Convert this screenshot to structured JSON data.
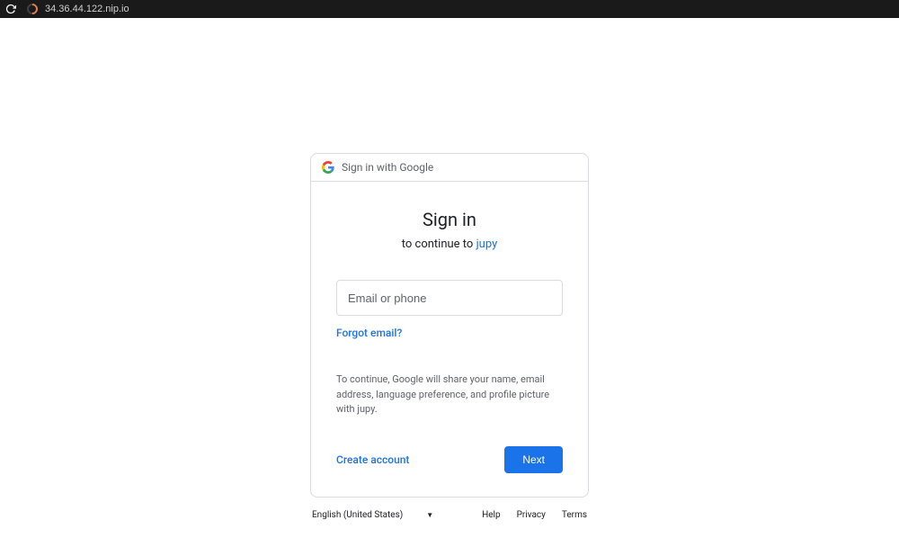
{
  "browser": {
    "url": "34.36.44.122.nip.io"
  },
  "card": {
    "header_text": "Sign in with Google",
    "title": "Sign in",
    "subtitle_prefix": "to continue to ",
    "app_name": "jupy",
    "email_placeholder": "Email or phone",
    "forgot_email": "Forgot email?",
    "disclaimer": "To continue, Google will share your name, email address, language preference, and profile picture with jupy.",
    "create_account": "Create account",
    "next": "Next"
  },
  "footer": {
    "language": "English (United States)",
    "help": "Help",
    "privacy": "Privacy",
    "terms": "Terms"
  }
}
